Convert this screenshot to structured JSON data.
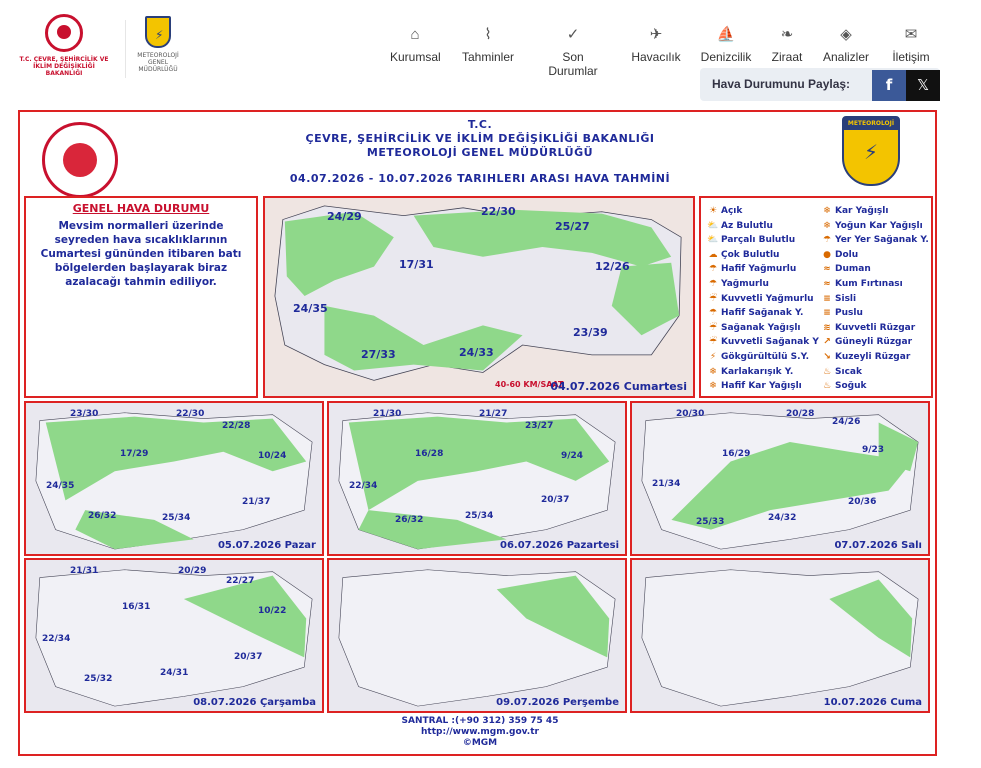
{
  "header": {
    "ministry_logo_text": "T.C. ÇEVRE, ŞEHİRCİLİK VE İKLİM DEĞİŞİKLİĞİ BAKANLIĞI",
    "mgm_logo_text": "METEOROLOJİ GENEL MÜDÜRLÜĞÜ",
    "mgm_badge": "METEOROLOJİ"
  },
  "nav": [
    {
      "label": "Kurumsal",
      "icon": "home-icon",
      "glyph": "⌂"
    },
    {
      "label": "Tahminler",
      "icon": "chart-icon",
      "glyph": "⌇"
    },
    {
      "label": "Son Durumlar",
      "icon": "check-circle-icon",
      "glyph": "✓"
    },
    {
      "label": "Havacılık",
      "icon": "airplane-icon",
      "glyph": "✈"
    },
    {
      "label": "Denizcilik",
      "icon": "sailboat-icon",
      "glyph": "⛵"
    },
    {
      "label": "Ziraat",
      "icon": "wheat-icon",
      "glyph": "❧"
    },
    {
      "label": "Analizler",
      "icon": "shapes-icon",
      "glyph": "◈"
    },
    {
      "label": "İletişim",
      "icon": "envelope-icon",
      "glyph": "✉"
    }
  ],
  "share": {
    "label": "Hava Durumunu Paylaş:",
    "facebook": "f",
    "x": "𝕏"
  },
  "forecast": {
    "title_line1": "T.C.",
    "title_line2": "ÇEVRE, ŞEHİRCİLİK VE İKLİM DEĞİŞİKLİĞİ BAKANLIĞI",
    "title_line3": "METEOROLOJİ GENEL MÜDÜRLÜĞÜ",
    "date_range": "04.07.2026 - 10.07.2026 TARIHLERI ARASI HAVA TAHMİNİ",
    "general_heading": "GENEL HAVA DURUMU",
    "general_text": "Mevsim normalleri üzerinde seyreden hava sıcaklıklarının Cumartesi gününden itibaren batı bölgelerden başlayarak biraz azalacağı tahmin ediliyor."
  },
  "main_map": {
    "date": "04.07.2026 Cumartesi",
    "temps": [
      "24/29",
      "22/30",
      "25/27",
      "17/31",
      "12/26",
      "24/35",
      "27/33",
      "24/33",
      "23/39"
    ],
    "wind_note": "40-60 KM/SAAT"
  },
  "days": [
    {
      "date": "05.07.2026 Pazar",
      "temps": [
        "23/30",
        "22/30",
        "22/28",
        "17/29",
        "10/24",
        "24/35",
        "26/32",
        "25/34",
        "21/37"
      ]
    },
    {
      "date": "06.07.2026 Pazartesi",
      "temps": [
        "21/30",
        "21/27",
        "23/27",
        "16/28",
        "9/24",
        "22/34",
        "26/32",
        "25/34",
        "20/37"
      ]
    },
    {
      "date": "07.07.2026 Salı",
      "temps": [
        "20/30",
        "20/28",
        "24/26",
        "16/29",
        "9/23",
        "21/34",
        "25/33",
        "24/32",
        "20/36"
      ]
    },
    {
      "date": "08.07.2026 Çarşamba",
      "temps": [
        "21/31",
        "20/29",
        "22/27",
        "16/31",
        "10/22",
        "22/34",
        "25/32",
        "24/31",
        "20/37"
      ]
    },
    {
      "date": "09.07.2026 Perşembe",
      "temps": []
    },
    {
      "date": "10.07.2026 Cuma",
      "temps": []
    }
  ],
  "legend_left": [
    "Açık",
    "Az Bulutlu",
    "Parçalı Bulutlu",
    "Çok Bulutlu",
    "Hafif Yağmurlu",
    "Yağmurlu",
    "Kuvvetli Yağmurlu",
    "Hafif Sağanak Y.",
    "Sağanak Yağışlı",
    "Kuvvetli Sağanak Y",
    "Gökgürültülü S.Y.",
    "Karlakarışık Y.",
    "Hafif Kar Yağışlı"
  ],
  "legend_right": [
    "Kar Yağışlı",
    "Yoğun Kar Yağışlı",
    "Yer Yer Sağanak Y.",
    "Dolu",
    "Duman",
    "Kum Fırtınası",
    "Sisli",
    "Puslu",
    "Kuvvetli Rüzgar",
    "Güneyli Rüzgar",
    "Kuzeyli Rüzgar",
    "Sıcak",
    "Soğuk"
  ],
  "footer": {
    "phone": "SANTRAL :(+90 312) 359 75 45",
    "url": "http://www.mgm.gov.tr",
    "copyright": "©MGM"
  },
  "colors": {
    "frame": "#dd2222",
    "text_blue": "#1f2a9a",
    "map_green": "#8fd88a",
    "map_gray": "#e9e8ef"
  }
}
